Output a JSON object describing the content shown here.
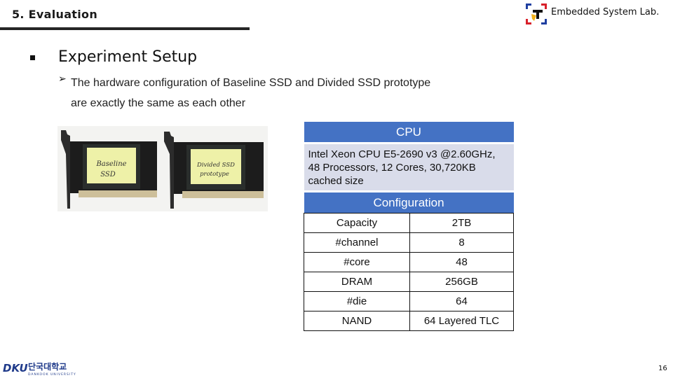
{
  "header": {
    "section_title": "5. Evaluation",
    "lab_name": "Embedded System Lab.",
    "lab_logo_icon": "embedded-lab-logo-icon"
  },
  "content": {
    "bullet_icon": "square-bullet-icon",
    "heading": "Experiment Setup",
    "sub_bullet_icon": "arrow-bullet-icon",
    "sub_bullet_glyph": "➢",
    "sub_text": "The hardware configuration of Baseline SSD and Divided SSD prototype are exactly the same as each other"
  },
  "photo": {
    "left_label_line1": "Baseline",
    "left_label_line2": "SSD",
    "right_label_line1": "Divided SSD",
    "right_label_line2": "prototype"
  },
  "spec_table": {
    "cpu_header": "CPU",
    "cpu_description": "Intel Xeon CPU E5-2690 v3 @2.60GHz, 48 Processors, 12 Cores, 30,720KB cached size",
    "config_header": "Configuration",
    "rows": [
      {
        "key": "Capacity",
        "value": "2TB"
      },
      {
        "key": "#channel",
        "value": "8"
      },
      {
        "key": "#core",
        "value": "48"
      },
      {
        "key": "DRAM",
        "value": "256GB"
      },
      {
        "key": "#die",
        "value": "64"
      },
      {
        "key": "NAND",
        "value": "64 Layered TLC"
      }
    ]
  },
  "footer": {
    "university_name_ko": "단국대학교",
    "university_name_en": "DANKOOK UNIVERSITY",
    "university_abbrev": "DKU",
    "page_number": "16"
  },
  "colors": {
    "table_header": "#4472c4",
    "cpu_body": "#d9dcea",
    "rule": "#262626"
  }
}
